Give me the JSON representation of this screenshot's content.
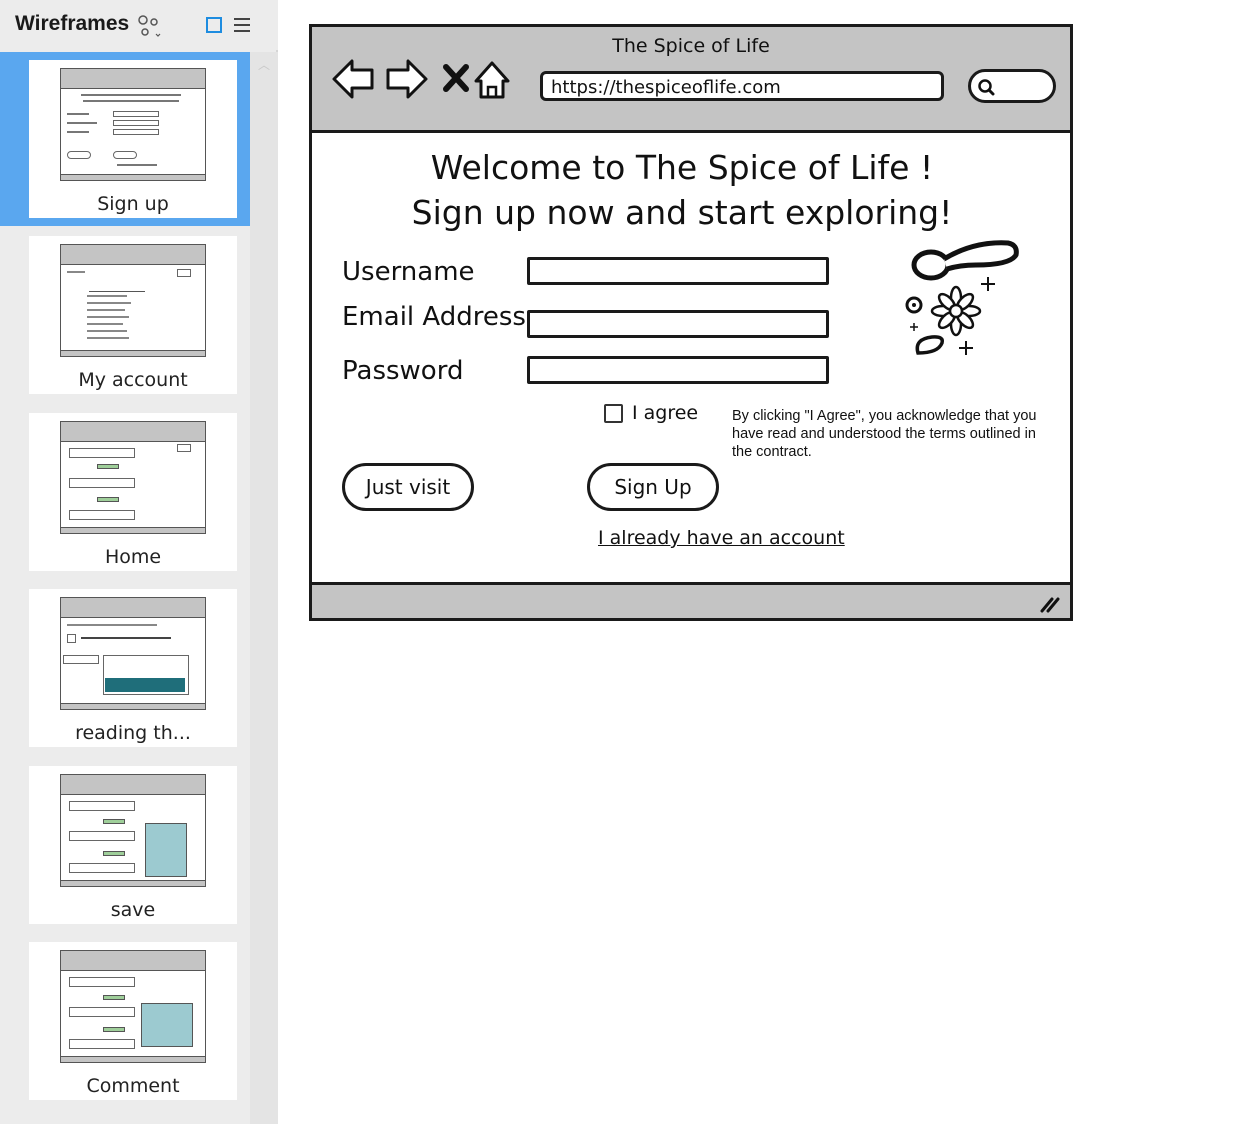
{
  "sidebar": {
    "title": "Wireframes",
    "pages": [
      {
        "label": "Sign up",
        "selected": true
      },
      {
        "label": "My account",
        "selected": false
      },
      {
        "label": "Home",
        "selected": false
      },
      {
        "label": "reading th...",
        "selected": false
      },
      {
        "label": "save",
        "selected": false
      },
      {
        "label": "Comment",
        "selected": false
      }
    ]
  },
  "browser": {
    "title": "The Spice of Life",
    "url": "https://thespiceoflife.com"
  },
  "content": {
    "headline_line1": "Welcome to The Spice of Life !",
    "headline_line2": "Sign up now and start exploring!",
    "username_label": "Username",
    "email_label": "Email Address",
    "password_label": "Password",
    "agree_label": "I agree",
    "terms_text": "By clicking \"I Agree\", you acknowledge that you have read and understood the terms outlined in the contract.",
    "just_visit_label": "Just visit",
    "sign_up_label": "Sign Up",
    "already_account_label": "I already have an account"
  },
  "colors": {
    "selected_page": "#5aa7ef",
    "browser_chrome": "#c4c4c4",
    "accent_icon": "#1d8ce0"
  }
}
